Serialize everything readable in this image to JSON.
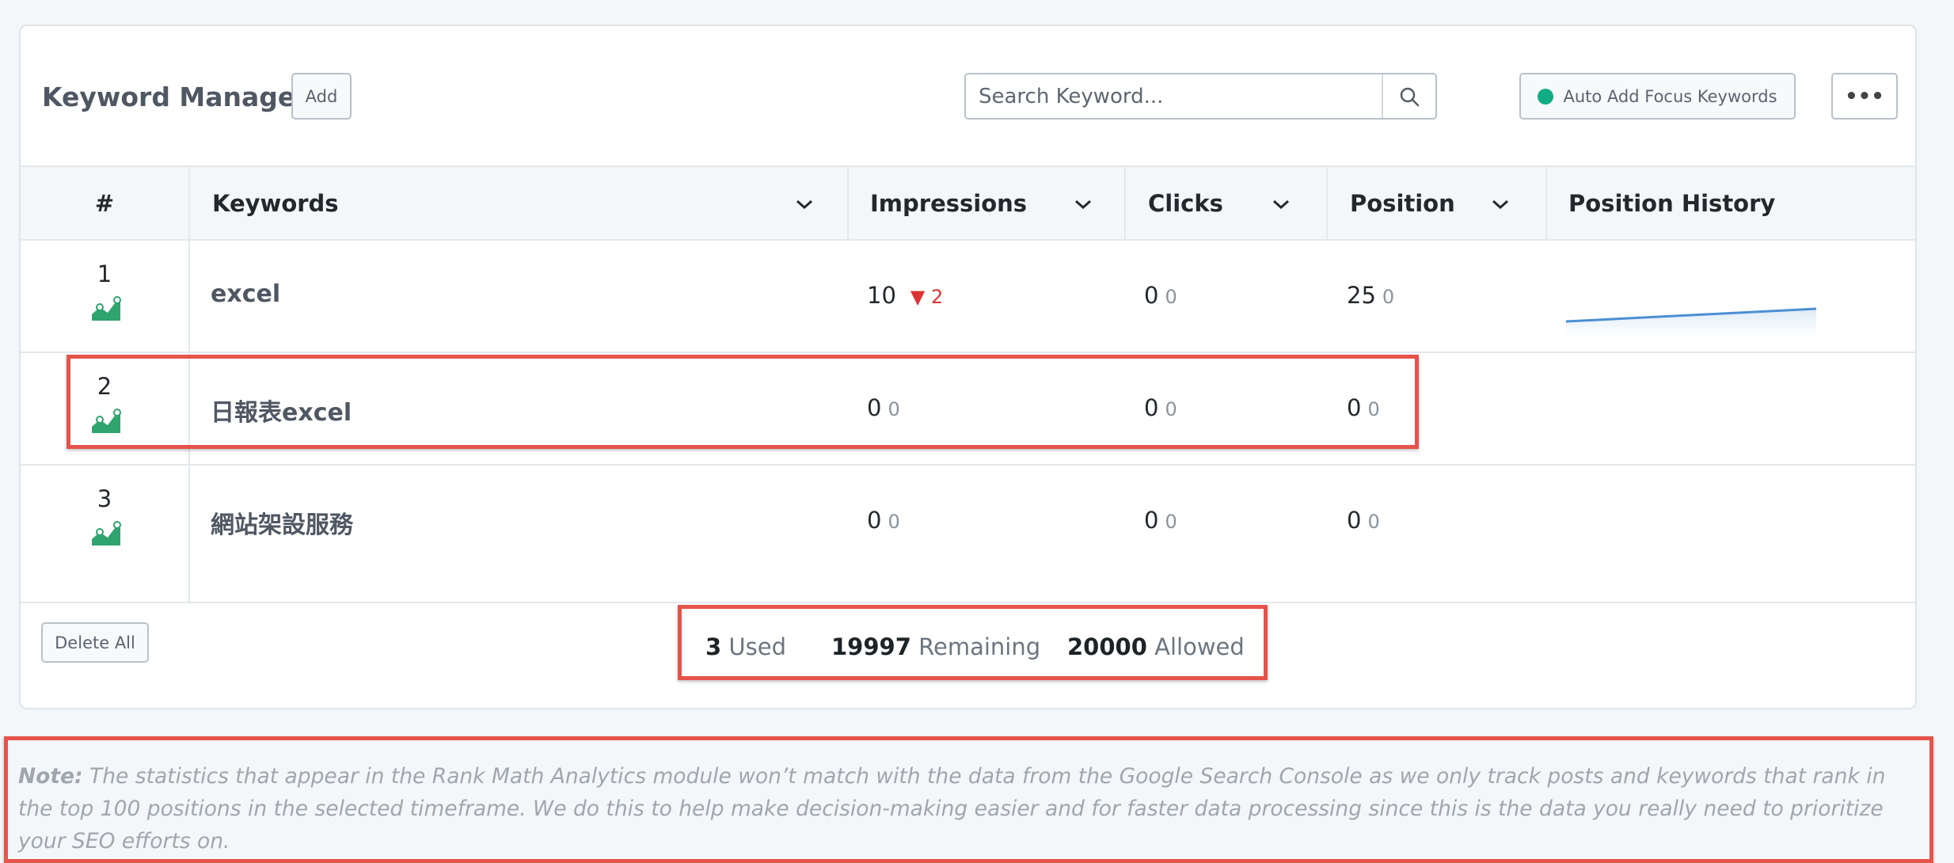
{
  "header": {
    "title": "Keyword Manager",
    "add_label": "Add",
    "search_placeholder": "Search Keyword...",
    "auto_add_label": "Auto Add Focus Keywords",
    "more_label": "•••"
  },
  "columns": [
    "#",
    "Keywords",
    "Impressions",
    "Clicks",
    "Position",
    "Position History"
  ],
  "rows": [
    {
      "num": "1",
      "keyword": "excel",
      "impressions": "10",
      "impressions_change": "2",
      "clicks": "0",
      "clicks_change": "0",
      "position": "25",
      "position_change": "0",
      "history": [
        0.2,
        0.6
      ]
    },
    {
      "num": "2",
      "keyword": "日報表excel",
      "impressions": "0",
      "impressions_change": "0",
      "clicks": "0",
      "clicks_change": "0",
      "position": "0",
      "position_change": "0"
    },
    {
      "num": "3",
      "keyword": "網站架設服務",
      "impressions": "0",
      "impressions_change": "0",
      "clicks": "0",
      "clicks_change": "0",
      "position": "0",
      "position_change": "0"
    }
  ],
  "footer": {
    "delete_all_label": "Delete All",
    "used_count": "3",
    "used_label": "Used",
    "remaining_count": "19997",
    "remaining_label": "Remaining",
    "allowed_count": "20000",
    "allowed_label": "Allowed"
  },
  "note": {
    "label": "Note:",
    "text": " The statistics that appear in the Rank Math Analytics module won’t match with the data from the Google Search Console as we only track posts and keywords that rank in the top 100 positions in the selected timeframe. We do this to help make decision-making easier and for faster data processing since this is the data you really need to prioritize your SEO efforts on."
  },
  "colors": {
    "accent_green": "#10ac84",
    "trend_icon": "#2fa46f",
    "down_red": "#dc3232",
    "line_blue": "#4a8fd4",
    "highlight_red": "#e5534b"
  },
  "icons": {
    "search": "search-icon",
    "trend": "trend-up-icon",
    "chevron": "chevron-down-icon"
  }
}
